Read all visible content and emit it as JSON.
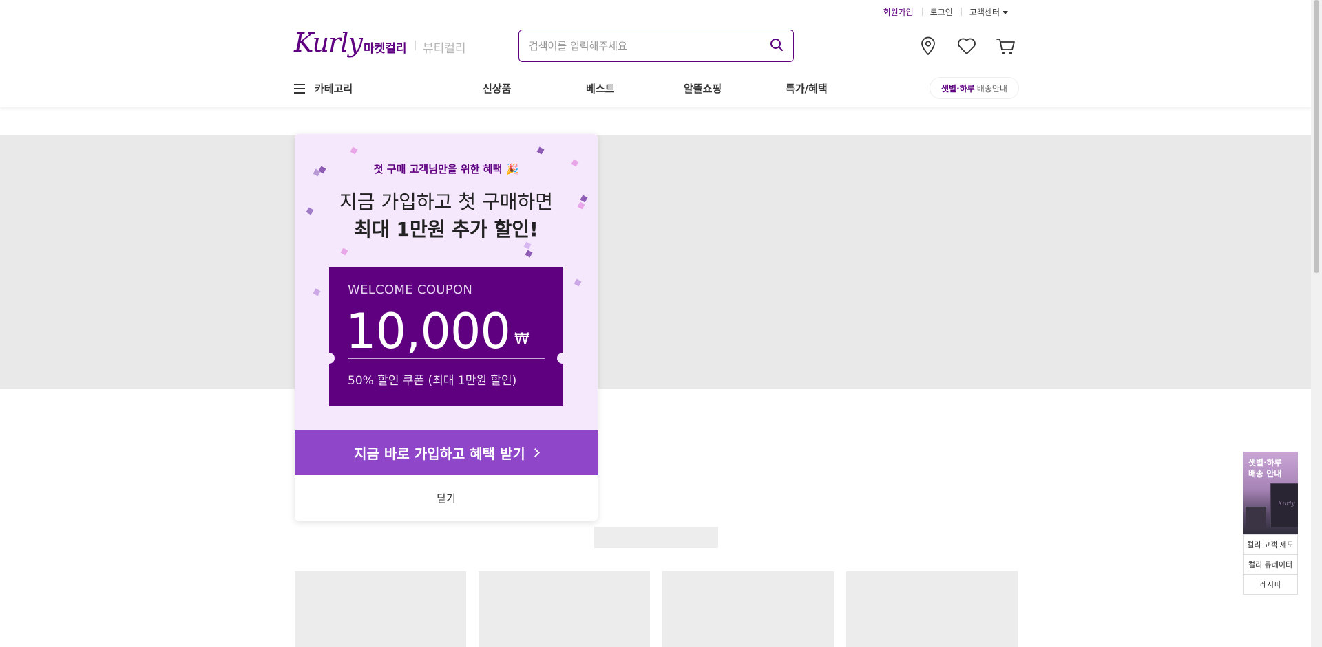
{
  "util": {
    "join": "회원가입",
    "login": "로그인",
    "customer_center": "고객센터"
  },
  "header": {
    "logo": "Kurly",
    "tab_market": "마켓컬리",
    "tab_beauty": "뷰티컬리",
    "search_placeholder": "검색어를 입력해주세요",
    "icons": [
      "location-icon",
      "heart-icon",
      "cart-icon"
    ]
  },
  "gnb": {
    "category": "카테고리",
    "items": [
      "신상품",
      "베스트",
      "알뜰쇼핑",
      "특가/혜택"
    ],
    "delivery_strong": "샛별·하루",
    "delivery_text": "배송안내"
  },
  "popup": {
    "subtitle": "첫 구매 고객님만을 위한 혜택",
    "subtitle_emoji": "🎉",
    "headline_1": "지금 가입하고 첫 구매하면",
    "headline_2": "최대 1만원 추가 할인!",
    "coupon_title": "WELCOME COUPON",
    "coupon_amount": "10,000",
    "coupon_currency": "₩",
    "coupon_desc": "50% 할인 쿠폰 (최대 1만원 할인)",
    "cta": "지금 바로 가입하고 혜택 받기",
    "close": "닫기"
  },
  "side": {
    "banner_line1": "샛별·하루",
    "banner_line2": "배송 안내",
    "banner_truck_label": "Kurly",
    "links": [
      "컬리 고객 제도",
      "컬리 큐레이터",
      "레시피"
    ]
  },
  "colors": {
    "brand": "#5f0080",
    "cta": "#8f46c9",
    "popup_bg": "#f6e8fc",
    "banner_bg": "#e9e9e9"
  }
}
